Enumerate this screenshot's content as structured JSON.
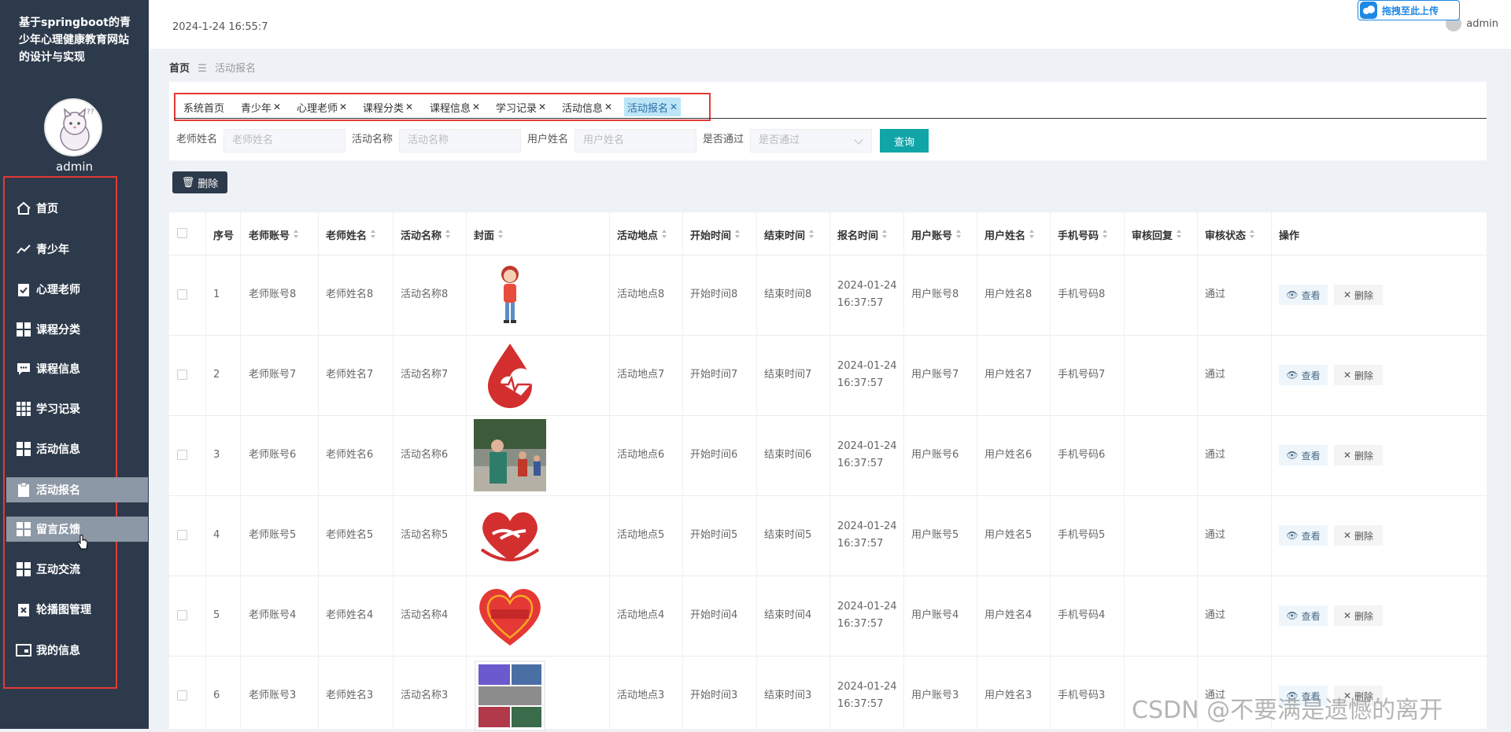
{
  "site": {
    "title": "基于springboot的青少年心理健康教育网站的设计与实现",
    "admin_name": "admin"
  },
  "header": {
    "datetime": "2024-1-24 16:55:7",
    "user": "admin",
    "upload_badge": "拖拽至此上传"
  },
  "sidebar": {
    "items": [
      {
        "label": "首页",
        "icon": "home-icon"
      },
      {
        "label": "青少年",
        "icon": "chart-line-icon"
      },
      {
        "label": "心理老师",
        "icon": "clipboard-check-icon"
      },
      {
        "label": "课程分类",
        "icon": "grid-icon"
      },
      {
        "label": "课程信息",
        "icon": "chat-icon"
      },
      {
        "label": "学习记录",
        "icon": "grid-nine-icon"
      },
      {
        "label": "活动信息",
        "icon": "grid-icon"
      },
      {
        "label": "活动报名",
        "icon": "clipboard-icon"
      },
      {
        "label": "留言反馈",
        "icon": "grid-icon"
      },
      {
        "label": "互动交流",
        "icon": "grid-icon"
      },
      {
        "label": "轮播图管理",
        "icon": "clipboard-x-icon"
      },
      {
        "label": "我的信息",
        "icon": "card-icon"
      }
    ]
  },
  "breadcrumb": {
    "home": "首页",
    "current": "活动报名"
  },
  "tabs": [
    {
      "label": "系统首页",
      "closable": false
    },
    {
      "label": "青少年",
      "closable": true
    },
    {
      "label": "心理老师",
      "closable": true
    },
    {
      "label": "课程分类",
      "closable": true
    },
    {
      "label": "课程信息",
      "closable": true
    },
    {
      "label": "学习记录",
      "closable": true
    },
    {
      "label": "活动信息",
      "closable": true
    },
    {
      "label": "活动报名",
      "closable": true
    }
  ],
  "search": {
    "teacher_name_label": "老师姓名",
    "teacher_name_placeholder": "老师姓名",
    "activity_name_label": "活动名称",
    "activity_name_placeholder": "活动名称",
    "user_name_label": "用户姓名",
    "user_name_placeholder": "用户姓名",
    "passed_label": "是否通过",
    "passed_placeholder": "是否通过",
    "query_button": "查询"
  },
  "toolbar": {
    "delete_button": "删除"
  },
  "table": {
    "headers": [
      "序号",
      "老师账号",
      "老师姓名",
      "活动名称",
      "封面",
      "活动地点",
      "开始时间",
      "结束时间",
      "报名时间",
      "用户账号",
      "用户姓名",
      "手机号码",
      "审核回复",
      "审核状态",
      "操作"
    ],
    "view_label": "查看",
    "delete_label": "删除",
    "rows": [
      {
        "idx": "1",
        "teacher_account": "老师账号8",
        "teacher_name": "老师姓名8",
        "activity": "活动名称8",
        "cover": "girl-figure",
        "location": "活动地点8",
        "start": "开始时间8",
        "end": "结束时间8",
        "signup_date": "2024-01-24",
        "signup_time": "16:37:57",
        "user_account": "用户账号8",
        "user_name": "用户姓名8",
        "phone": "手机号码8",
        "reply": "",
        "status": "通过"
      },
      {
        "idx": "2",
        "teacher_account": "老师账号7",
        "teacher_name": "老师姓名7",
        "activity": "活动名称7",
        "cover": "blood-drop",
        "location": "活动地点7",
        "start": "开始时间7",
        "end": "结束时间7",
        "signup_date": "2024-01-24",
        "signup_time": "16:37:57",
        "user_account": "用户账号7",
        "user_name": "用户姓名7",
        "phone": "手机号码7",
        "reply": "",
        "status": "通过"
      },
      {
        "idx": "3",
        "teacher_account": "老师账号6",
        "teacher_name": "老师姓名6",
        "activity": "活动名称6",
        "cover": "photo",
        "location": "活动地点6",
        "start": "开始时间6",
        "end": "结束时间6",
        "signup_date": "2024-01-24",
        "signup_time": "16:37:57",
        "user_account": "用户账号6",
        "user_name": "用户姓名6",
        "phone": "手机号码6",
        "reply": "",
        "status": "通过"
      },
      {
        "idx": "4",
        "teacher_account": "老师账号5",
        "teacher_name": "老师姓名5",
        "activity": "活动名称5",
        "cover": "heart-hands",
        "location": "活动地点5",
        "start": "开始时间5",
        "end": "结束时间5",
        "signup_date": "2024-01-24",
        "signup_time": "16:37:57",
        "user_account": "用户账号5",
        "user_name": "用户姓名5",
        "phone": "手机号码5",
        "reply": "",
        "status": "通过"
      },
      {
        "idx": "5",
        "teacher_account": "老师账号4",
        "teacher_name": "老师姓名4",
        "activity": "活动名称4",
        "cover": "heart-charity",
        "location": "活动地点4",
        "start": "开始时间4",
        "end": "结束时间4",
        "signup_date": "2024-01-24",
        "signup_time": "16:37:57",
        "user_account": "用户账号4",
        "user_name": "用户姓名4",
        "phone": "手机号码4",
        "reply": "",
        "status": "通过"
      },
      {
        "idx": "6",
        "teacher_account": "老师账号3",
        "teacher_name": "老师姓名3",
        "activity": "活动名称3",
        "cover": "collage",
        "location": "活动地点3",
        "start": "开始时间3",
        "end": "结束时间3",
        "signup_date": "2024-01-24",
        "signup_time": "16:37:57",
        "user_account": "用户账号3",
        "user_name": "用户姓名3",
        "phone": "手机号码3",
        "reply": "",
        "status": "通过"
      }
    ]
  },
  "watermark": "CSDN @不要满是遗憾的离开",
  "colors": {
    "sidebar_bg": "#2d3a4b",
    "accent": "#12a5a7",
    "highlight": "#e53935"
  }
}
